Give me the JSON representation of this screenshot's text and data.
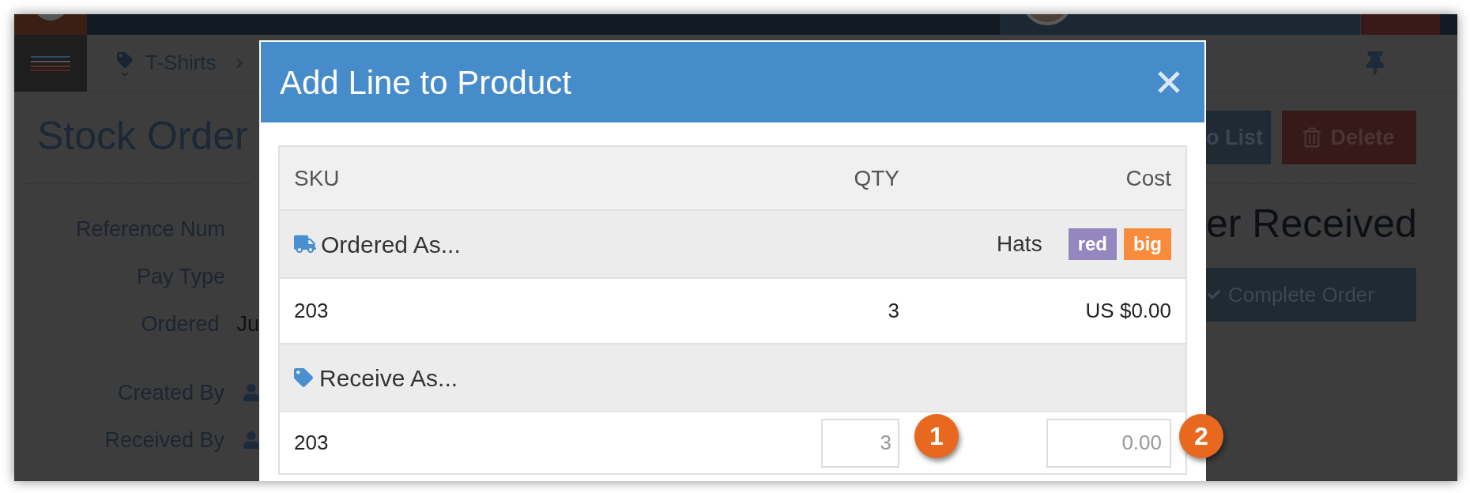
{
  "breadcrumb": [
    {
      "label": "T-Shirts"
    }
  ],
  "page": {
    "title": "Stock Order",
    "fields": [
      {
        "label": "Reference Num",
        "kind": "text"
      },
      {
        "label": "Pay Type",
        "kind": "text"
      },
      {
        "label": "Ordered",
        "kind": "text",
        "value": "Ju"
      },
      {
        "label": "Created By",
        "kind": "user"
      },
      {
        "label": "Received By",
        "kind": "user"
      }
    ],
    "buttons": [
      {
        "label": "o List",
        "kind": "plain"
      },
      {
        "label": "Delete",
        "kind": "delete"
      }
    ],
    "status": "er Received",
    "complete_button": "Complete Order"
  },
  "modal": {
    "title": "Add Line to Product",
    "columns": [
      "SKU",
      "QTY",
      "Cost"
    ],
    "sections": [
      {
        "kind": "ordered",
        "label": "Ordered As...",
        "product": "Hats",
        "tags": [
          {
            "label": "red",
            "color": "#9487c0"
          },
          {
            "label": "big",
            "color": "#f98c3c"
          }
        ],
        "row": {
          "sku": "203",
          "qty": "3",
          "cost": "US $0.00"
        }
      },
      {
        "kind": "receive",
        "label": "Receive As...",
        "row": {
          "sku": "203",
          "qty_placeholder": "3",
          "cost_placeholder": "0.00"
        }
      }
    ]
  },
  "callouts": [
    "1",
    "2"
  ]
}
